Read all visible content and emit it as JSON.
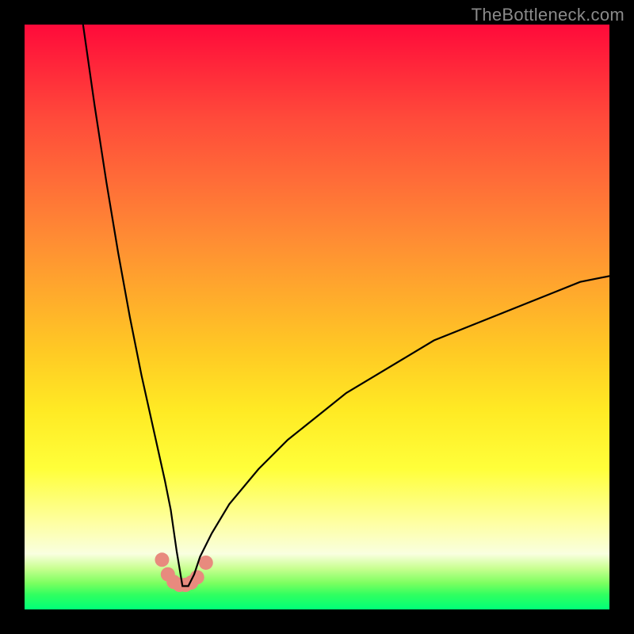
{
  "watermark": {
    "text": "TheBottleneck.com"
  },
  "chart_data": {
    "type": "line",
    "title": "",
    "xlabel": "",
    "ylabel": "",
    "xlim": [
      0,
      100
    ],
    "ylim": [
      0,
      100
    ],
    "grid": false,
    "legend": false,
    "curve_note": "V-shaped bottleneck curve; minimum ≈ x 27, y ≈ 4; y ≈ 100 at x ≈ 10 (left) and y ≈ 57 at x = 100 (right).",
    "series": [
      {
        "name": "bottleneck-curve",
        "x": [
          10,
          12,
          14,
          16,
          18,
          20,
          22,
          24,
          25,
          26,
          27,
          28,
          29,
          30,
          32,
          35,
          40,
          45,
          50,
          55,
          60,
          65,
          70,
          75,
          80,
          85,
          90,
          95,
          100
        ],
        "y": [
          100,
          86,
          73,
          61,
          50,
          40,
          31,
          22,
          17,
          10,
          4,
          4,
          6,
          9,
          13,
          18,
          24,
          29,
          33,
          37,
          40,
          43,
          46,
          48,
          50,
          52,
          54,
          56,
          57
        ]
      }
    ],
    "markers": {
      "note": "salmon dot markers clustered along the curve near its minimum",
      "color": "#e88a7e",
      "x": [
        23.5,
        24.5,
        25.5,
        26.5,
        27.5,
        28.5,
        29.5,
        31.0
      ],
      "y": [
        8.5,
        6.0,
        4.7,
        4.2,
        4.2,
        4.6,
        5.5,
        8.0
      ]
    },
    "background_gradient": {
      "type": "vertical",
      "stops": [
        {
          "pos": 0.0,
          "color": "#ff0a3a"
        },
        {
          "pos": 0.3,
          "color": "#ff7a36"
        },
        {
          "pos": 0.6,
          "color": "#ffdf24"
        },
        {
          "pos": 0.85,
          "color": "#feffa0"
        },
        {
          "pos": 1.0,
          "color": "#00ff78"
        }
      ]
    }
  }
}
